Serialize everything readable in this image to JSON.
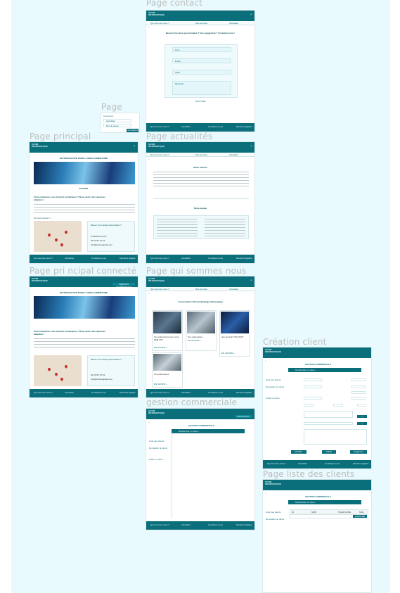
{
  "labels": {
    "page_contact": "Page contact",
    "page": "Page",
    "page_principal": "Page principal",
    "page_actualites": "Page actualités",
    "page_principal_connecte": "Page pri ncipal connecté",
    "page_qui_sommes_nous": "Page qui sommes nous",
    "gestion_commerciale": "gestion commerciale",
    "creation_client": "Création client",
    "page_liste_clients": "Page liste des clients"
  },
  "nav": {
    "qui_sommes_nous": "Qui sommes-nous ?",
    "nos_services": "Nos services",
    "actualites": "Actualités",
    "contactez_nous": "Contactez-nous",
    "mentions": "Mentions légales"
  },
  "brand": {
    "name": "INFORMATIQUE",
    "tagline": "DR SPECIALISTE DANS L'AGRO-ALIMENTAIRE"
  },
  "contact": {
    "heading": "Besoin d'un devis personnalisé ? Une suggestion ? Contactez nous !",
    "fields": [
      "Nom",
      "Email",
      "Sujet",
      "Message"
    ],
    "submit": "ENVOYER"
  },
  "login": {
    "title": "Connexion",
    "user_placeholder": "Identifiant",
    "pass_placeholder": "Mot de passe",
    "button": "Connexion"
  },
  "principal": {
    "accueil": "ACCUEIL",
    "question": "Votre entreprise a des besoins numériques ? Nous avons des réponses adaptées !",
    "where": "Où nous trouver ?",
    "devis": "Besoin d'un devis personnalisé ?",
    "contact_link": "Contactez-nous !",
    "phone": "02 33 00 76 23",
    "email": "info@cursusgrade.com"
  },
  "actualites": {
    "title1": "Notre histoire",
    "title2": "Notre équipe"
  },
  "qui": {
    "heading": "L'ecosystème d'Ucom Stratégie Informatique",
    "cards": [
      {
        "title": "Nos partenaires pour votre PME PMI",
        "link": "EN SAVOIR +"
      },
      {
        "title": "Nos partenaires",
        "link": "EN SAVOIR +"
      },
      {
        "title": "Jeu de Noël \"ISO 2020\"",
        "link": "EN SAVOIR +"
      },
      {
        "title": "Nos partenaires",
        "link": "EN SAVOIR +"
      }
    ]
  },
  "gestion": {
    "title": "GESTION COMMERCIALE",
    "search": "Rechercher un client...",
    "side": [
      "Liste des clients",
      "Demander un devis",
      "Créer un client"
    ],
    "user": "Déconnexion"
  },
  "creation": {
    "title": "GESTION COMMERCIALE",
    "search": "Rechercher un client...",
    "side": [
      "Liste des clients",
      "Demander un devis",
      "Créer un client"
    ],
    "buttons": [
      "Modifier",
      "Valider",
      "Supprimer"
    ]
  },
  "liste": {
    "title": "GESTION COMMERCIALE",
    "search": "Rechercher un client...",
    "side": [
      "Liste des clients",
      "Demander un devis"
    ],
    "columns": [
      "ID",
      "NOM",
      "TELEPHONE",
      "MAIL"
    ],
    "add_button": "AJOUTER"
  },
  "colors": {
    "brand": "#0b6f7b",
    "canvas": "#e8fafd",
    "label": "#bdbdbd"
  }
}
